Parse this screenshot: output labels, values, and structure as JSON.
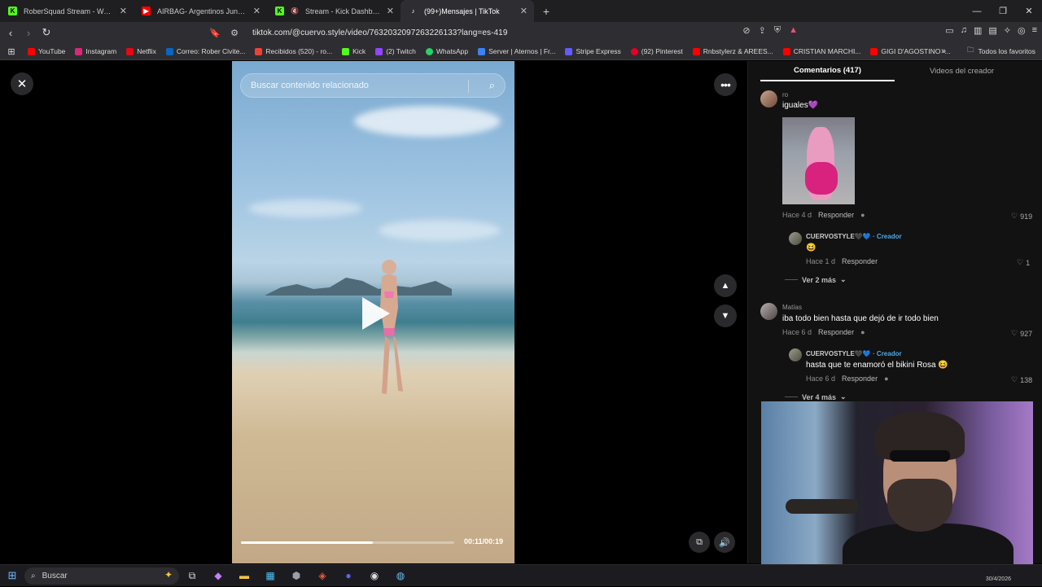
{
  "browser": {
    "tabs": [
      {
        "title": "RoberSquad Stream - Watch Live",
        "favicon": "kick-icon",
        "color": "#53fc18",
        "active": false
      },
      {
        "title": "AIRBAG- Argentinos Juniors - EN VIVO",
        "favicon": "youtube-icon",
        "color": "#ff0000",
        "active": false
      },
      {
        "title": "Stream - Kick Dashboard",
        "favicon": "kick-icon",
        "color": "#53fc18",
        "active": false
      },
      {
        "title": "(99+)Mensajes | TikTok",
        "favicon": "tiktok-icon",
        "color": "#ffffff",
        "active": true
      }
    ],
    "url": "tiktok.com/@cuervo.style/video/7632032097263226133?lang=es-419",
    "bookmarks": [
      {
        "label": "YouTube",
        "color": "#ff0000"
      },
      {
        "label": "Instagram",
        "color": "#d62976"
      },
      {
        "label": "Netflix",
        "color": "#e50914"
      },
      {
        "label": "Correo: Rober Civite...",
        "color": "#0a66c2"
      },
      {
        "label": "Recibidos (520) - ro...",
        "color": "#ea4335"
      },
      {
        "label": "Kick",
        "color": "#53fc18"
      },
      {
        "label": "(2) Twitch",
        "color": "#9146ff"
      },
      {
        "label": "WhatsApp",
        "color": "#25d366"
      },
      {
        "label": "Server | Aternos | Fr...",
        "color": "#3b82f6"
      },
      {
        "label": "Stripe Express",
        "color": "#635bff"
      },
      {
        "label": "(92) Pinterest",
        "color": "#e60023"
      },
      {
        "label": "Rnbstylerz & AREES...",
        "color": "#ff0000"
      },
      {
        "label": "CRISTIAN MARCHI...",
        "color": "#ff0000"
      },
      {
        "label": "GIGI D'AGOSTINO -...",
        "color": "#ff0000"
      }
    ],
    "bookmarks_all": "Todos los favoritos"
  },
  "video": {
    "search_placeholder": "Buscar contenido relacionado",
    "timecode": "00:11/00:19",
    "progress_fraction": 0.62
  },
  "comments_panel": {
    "tabs": [
      {
        "label": "Comentarios (417)",
        "active": true
      },
      {
        "label": "Videos del creador",
        "active": false
      }
    ],
    "comments": [
      {
        "user": "ro",
        "text": "iguales💜",
        "time": "Hace 4 d",
        "reply": "Responder",
        "likes": "919"
      },
      {
        "user": "CUERVOSTYLE🖤💙",
        "creator": "· Creador",
        "text": "😆",
        "time": "Hace 1 d",
        "reply": "Responder",
        "likes": "1"
      },
      {
        "more": "Ver 2 más"
      },
      {
        "user": "Matías",
        "text": "iba todo bien hasta que dejó de ir todo bien",
        "time": "Hace 6 d",
        "reply": "Responder",
        "likes": "927"
      },
      {
        "user": "CUERVOSTYLE🖤💙",
        "creator": "· Creador",
        "text": "hasta que te enamoró el bikini Rosa 😆",
        "time": "Hace 6 d",
        "reply": "Responder",
        "likes": "138"
      },
      {
        "more": "Ver 4 más"
      }
    ]
  },
  "taskbar": {
    "search_label": "Buscar",
    "date": "30/4/2026"
  }
}
